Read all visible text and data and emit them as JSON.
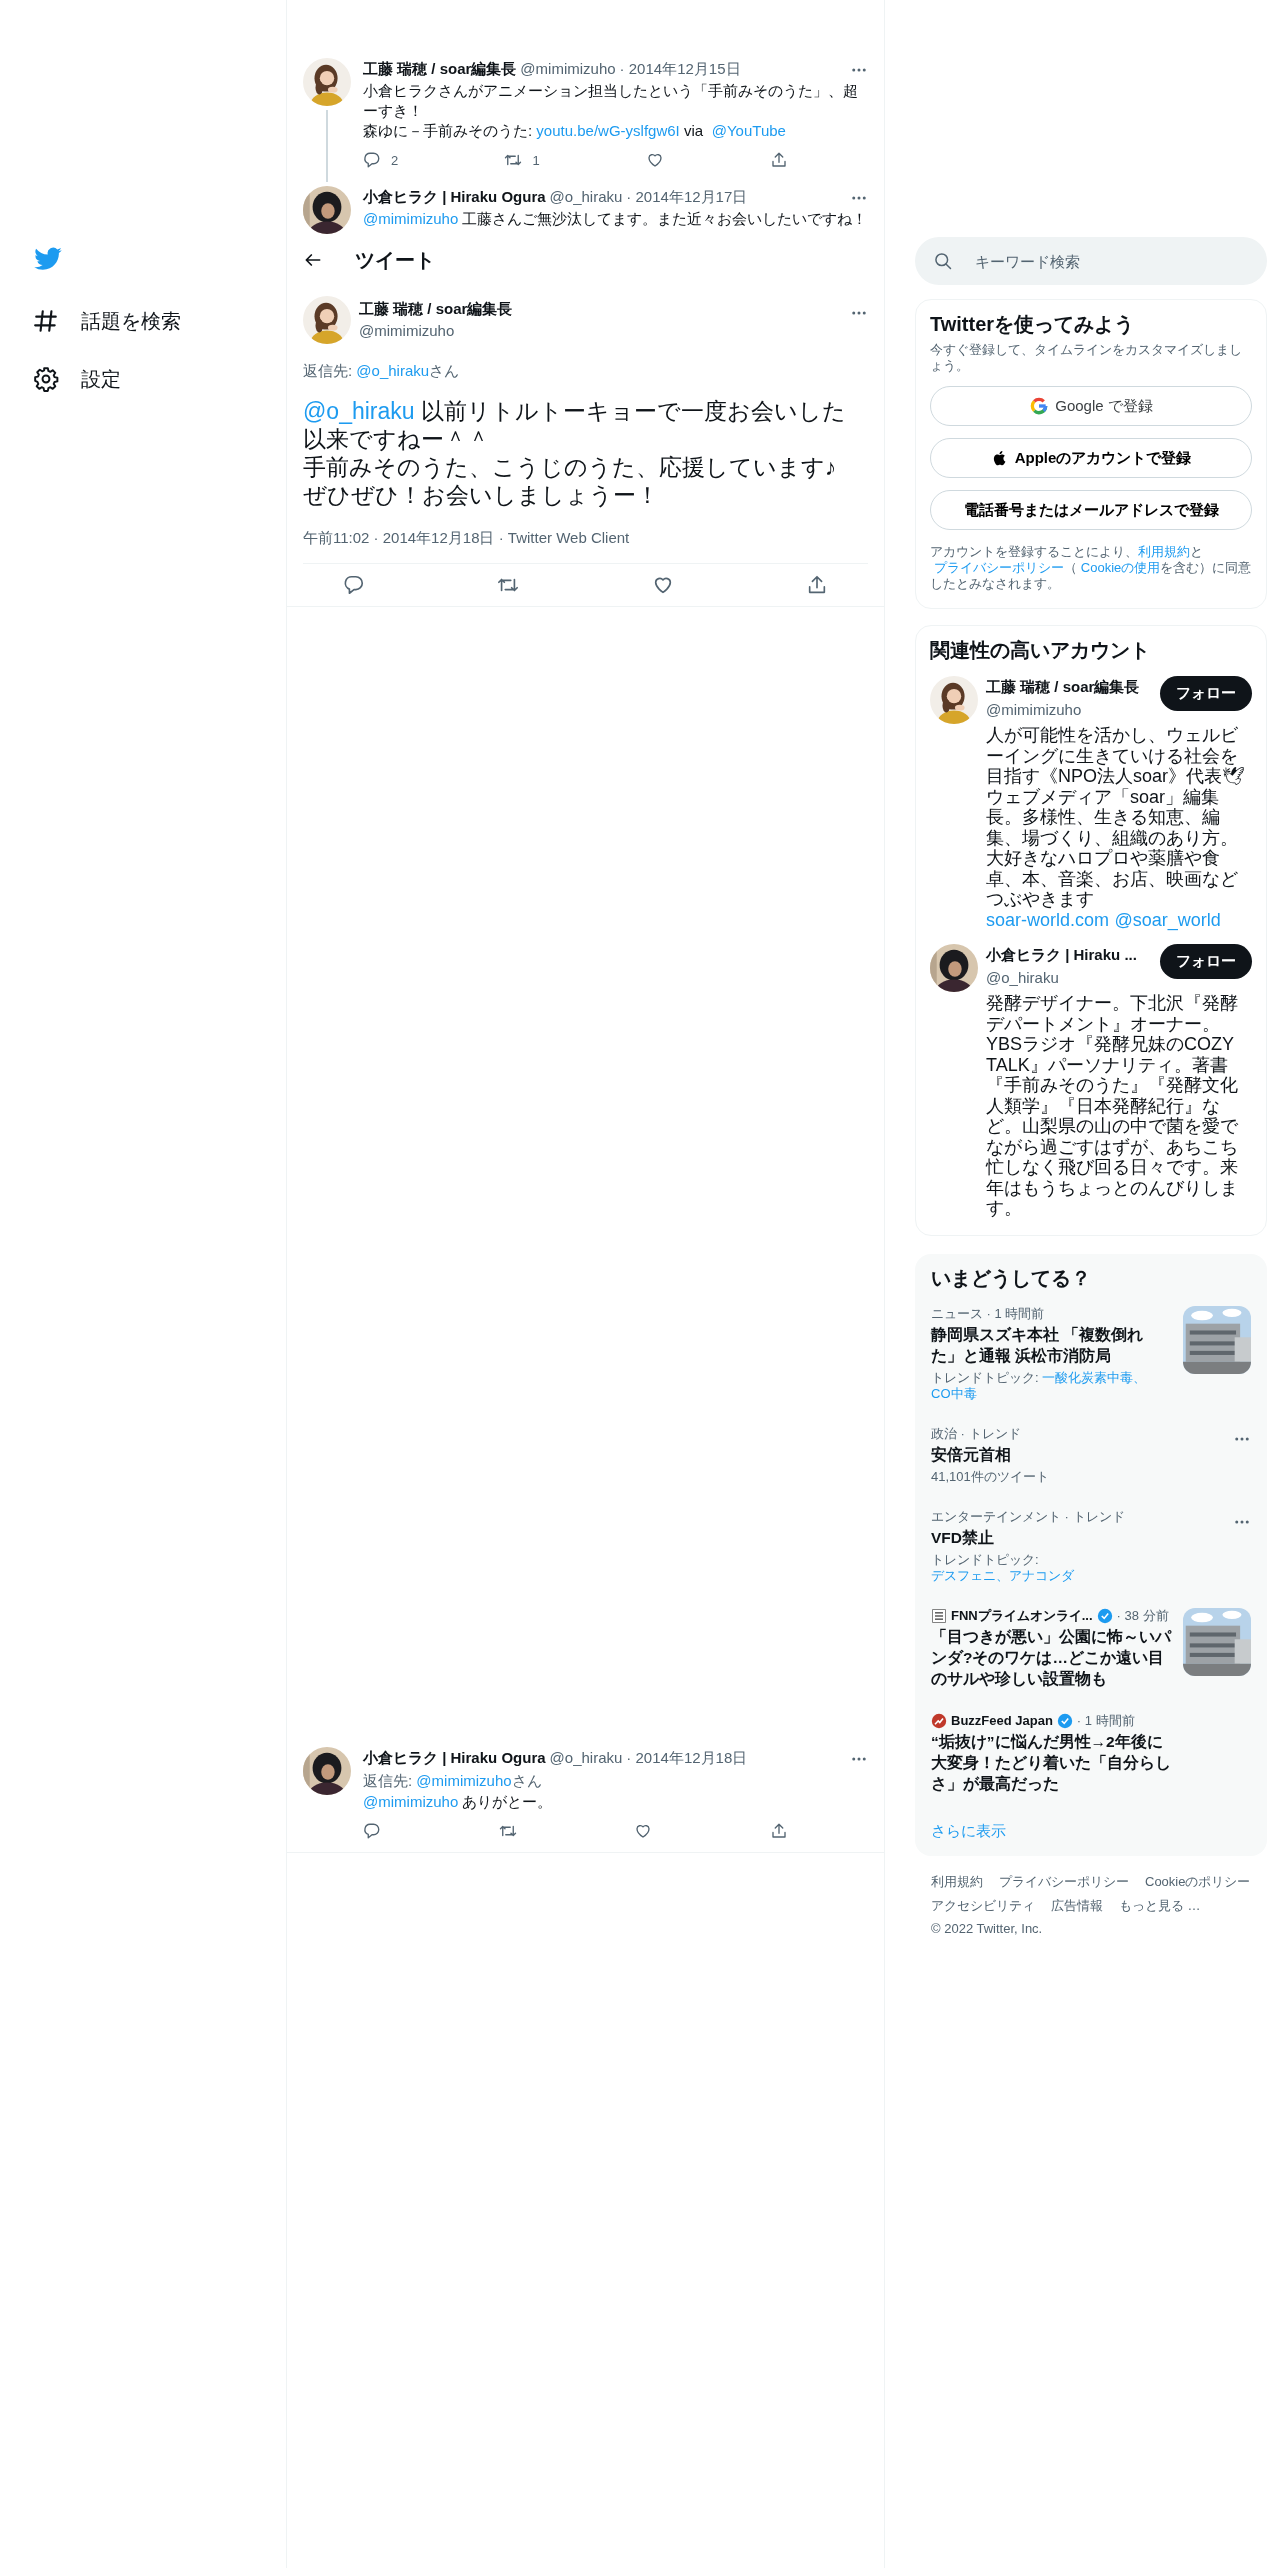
{
  "sidebar": {
    "items": [
      {
        "label": "話題を検索"
      },
      {
        "label": "設定"
      }
    ]
  },
  "thread": [
    {
      "name": "工藤 瑞穂 / soar編集長",
      "handle": "@mimimizuho",
      "date": "· 2014年12月15日",
      "paragraphs": [
        [
          {
            "kind": "text",
            "text": "小倉ヒラクさんがアニメーション担当したという「手前みそのうた」、超ーすき！"
          }
        ],
        [
          {
            "kind": "text",
            "text": "森ゆに－手前みそのうた: "
          },
          {
            "kind": "link",
            "text": "youtu.be/wG-yslfgw6I"
          },
          {
            "kind": "text",
            "text": " via "
          },
          {
            "kind": "link",
            "text": "@YouTube"
          }
        ]
      ],
      "replies": "2",
      "retweets": "1",
      "avatar": {
        "kind": "picture"
      }
    },
    {
      "name": "小倉ヒラク | Hiraku Ogura",
      "handle": "@o_hiraku",
      "date": "· 2014年12月17日",
      "paragraphs": [
        [
          {
            "kind": "link",
            "text": "@mimimizuho"
          },
          {
            "kind": "text",
            "text": " 工藤さんご無沙汰してます。また近々お会いしたいですね！"
          }
        ]
      ],
      "avatar": {
        "kind": "picture"
      }
    }
  ],
  "header": {
    "title": "ツイート"
  },
  "main_tweet": {
    "name": "工藤 瑞穂 / soar編集長",
    "handle": "@mimimizuho",
    "avatar": {
      "kind": "picture"
    },
    "reply_to": [
      {
        "kind": "text",
        "text": "返信先: "
      },
      {
        "kind": "link",
        "text": "@o_hiraku"
      },
      {
        "kind": "text",
        "text": "さん"
      }
    ],
    "paragraphs": [
      [
        {
          "kind": "link",
          "text": "@o_hiraku"
        },
        {
          "kind": "text",
          "text": " 以前リトルトーキョーで一度お会いした以来ですねー＾＾"
        }
      ],
      [
        {
          "kind": "text",
          "text": "手前みそのうた、こうじのうた、応援しています♪"
        }
      ],
      [
        {
          "kind": "text",
          "text": "ぜひぜひ！お会いしましょうー！"
        }
      ]
    ],
    "meta": "午前11:02 · 2014年12月18日 · Twitter Web Client"
  },
  "reply": {
    "name": "小倉ヒラク | Hiraku Ogura",
    "handle": "@o_hiraku",
    "date": "· 2014年12月18日",
    "avatar": {
      "kind": "picture"
    },
    "reply_to": [
      {
        "kind": "text",
        "text": "返信先: "
      },
      {
        "kind": "link",
        "text": "@mimimizuho"
      },
      {
        "kind": "text",
        "text": "さん"
      }
    ],
    "paragraphs": [
      [
        {
          "kind": "link",
          "text": "@mimimizuho"
        },
        {
          "kind": "text",
          "text": " ありがとー。"
        }
      ]
    ]
  },
  "search": {
    "placeholder": "キーワード検索"
  },
  "signup": {
    "title": "Twitterを使ってみよう",
    "subtitle": "今すぐ登録して、タイムラインをカスタマイズしましょう。",
    "buttons": [
      {
        "label": "Google で登録",
        "kind": "google"
      },
      {
        "label": "Appleのアカウントで登録",
        "kind": "apple"
      },
      {
        "label": "電話番号またはメールアドレスで登録",
        "kind": "plain"
      }
    ],
    "legal": [
      {
        "kind": "text",
        "text": "アカウントを登録することにより、"
      },
      {
        "kind": "link",
        "text": "利用規約"
      },
      {
        "kind": "text",
        "text": "と"
      },
      {
        "kind": "link",
        "text": "プライバシーポリシー"
      },
      {
        "kind": "text",
        "text": "（"
      },
      {
        "kind": "link",
        "text": "Cookieの使用"
      },
      {
        "kind": "text",
        "text": "を含む）に同意したとみなされます。"
      }
    ]
  },
  "who_to_follow": {
    "title": "関連性の高いアカウント",
    "accounts": [
      {
        "name": "工藤 瑞穂 / soar編集長",
        "handle": "@mimimizuho",
        "button": "フォロー",
        "avatar": {
          "kind": "picture"
        },
        "bio": [
          {
            "kind": "text",
            "text": "人が可能性を活かし、ウェルビーイングに生きていける社会を目指す《NPO法人soar》代表🕊ウェブメディア「soar」編集長。多様性、生きる知恵、編集、場づくり、組織のあり方。大好きなハロプロや薬膳や食卓、本、音楽、お店、映画などつぶやきます "
          },
          {
            "kind": "link",
            "text": "soar-world.com"
          },
          {
            "kind": "link",
            "text": "@soar_world"
          }
        ]
      },
      {
        "name": "小倉ヒラク | Hiraku ...",
        "handle": "@o_hiraku",
        "button": "フォロー",
        "avatar": {
          "kind": "picture"
        },
        "bio": [
          {
            "kind": "text",
            "text": "発酵デザイナー。下北沢『発酵デパートメント』オーナー。YBSラジオ『発酵兄妹のCOZY TALK』パーソナリティ。著書『手前みそのうた』『発酵文化人類学』『日本発酵紀行』など。山梨県の山の中で菌を愛でながら過ごすはずが、あちこち忙しなく飛び回る日々です。来年はもうちょっとのんびりします。"
          }
        ]
      }
    ]
  },
  "trends": {
    "title": "いまどうしてる？",
    "items": [
      {
        "kind": "news",
        "meta": "ニュース · 1 時間前",
        "headline": "静岡県スズキ本社 「複数倒れた」と通報 浜松市消防局",
        "topics_label": "トレンドトピック: ",
        "topics": [
          "一酸化炭素中毒、",
          "CO中毒"
        ],
        "thumbnail": {
          "kind": "picture"
        }
      },
      {
        "kind": "trend",
        "meta": "政治 · トレンド",
        "headline": "安倍元首相",
        "count": "41,101件のツイート"
      },
      {
        "kind": "trend",
        "meta": "エンターテインメント · トレンド",
        "headline": "VFD禁止",
        "topics_label": "トレンドトピック: ",
        "topics": [
          "デスフェニ、アナコンダ"
        ]
      },
      {
        "kind": "publisher",
        "source": "FNNプライムオンライ...",
        "verified": true,
        "time": "· 38 分前",
        "headline": "「目つきが悪い」公園に怖～いパンダ?そのワケは…どこか遠い目のサルや珍しい設置物も",
        "thumbnail": {
          "kind": "picture"
        }
      },
      {
        "kind": "publisher",
        "source": "BuzzFeed Japan",
        "verified": true,
        "time": "· 1 時間前",
        "headline": "“垢抜け”に悩んだ男性→2年後に大変身！たどり着いた「自分らしさ」が最高だった"
      }
    ],
    "show_more": "さらに表示"
  },
  "footer": {
    "links": [
      "利用規約",
      "プライバシーポリシー",
      "Cookieのポリシー",
      "アクセシビリティ",
      "広告情報",
      "もっと見る …"
    ],
    "copyright": "© 2022 Twitter, Inc."
  }
}
